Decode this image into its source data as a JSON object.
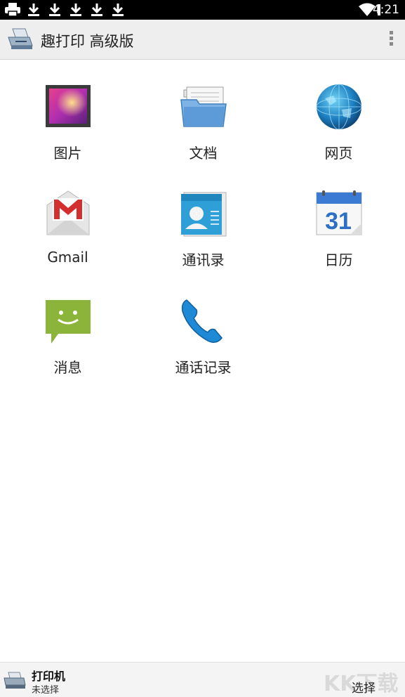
{
  "status_bar": {
    "time": "4:21",
    "icons": [
      "printer-icon",
      "download-icon",
      "download-icon",
      "download-icon",
      "download-icon",
      "download-icon",
      "wifi-icon",
      "battery-icon"
    ]
  },
  "action_bar": {
    "title": "趣打印 高级版",
    "logo": "printer-app-logo",
    "menu": "overflow-menu-icon"
  },
  "grid": [
    {
      "label": "图片",
      "icon": "gallery-icon"
    },
    {
      "label": "文档",
      "icon": "folder-icon"
    },
    {
      "label": "网页",
      "icon": "globe-icon"
    },
    {
      "label": "Gmail",
      "icon": "gmail-icon"
    },
    {
      "label": "通讯录",
      "icon": "contacts-icon"
    },
    {
      "label": "日历",
      "icon": "calendar-icon"
    },
    {
      "label": "消息",
      "icon": "message-icon"
    },
    {
      "label": "通话记录",
      "icon": "phone-icon"
    }
  ],
  "calendar_day": "31",
  "bottom_bar": {
    "printer_title": "打印机",
    "printer_status": "未选择",
    "select_label": "选择",
    "watermark": "KK下载"
  }
}
